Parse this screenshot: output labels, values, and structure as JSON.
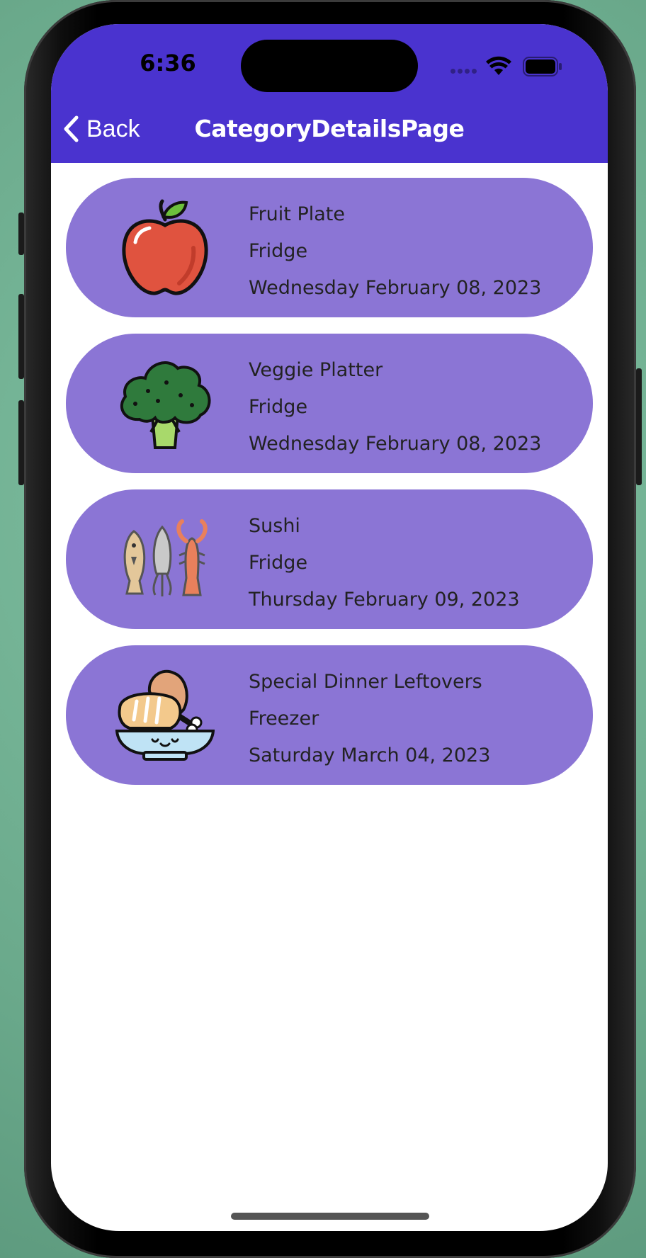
{
  "status_bar": {
    "time": "6:36"
  },
  "nav": {
    "back_label": "Back",
    "title": "CategoryDetailsPage"
  },
  "items": [
    {
      "icon": "apple-icon",
      "name": "Fruit Plate",
      "location": "Fridge",
      "date": "Wednesday February 08, 2023"
    },
    {
      "icon": "broccoli-icon",
      "name": "Veggie Platter",
      "location": "Fridge",
      "date": "Wednesday February 08, 2023"
    },
    {
      "icon": "seafood-icon",
      "name": "Sushi",
      "location": "Fridge",
      "date": "Thursday February 09, 2023"
    },
    {
      "icon": "dinner-plate-icon",
      "name": "Special Dinner Leftovers",
      "location": "Freezer",
      "date": "Saturday March 04, 2023"
    }
  ],
  "colors": {
    "nav_bar": "#4a33cf",
    "card": "#8b75d5",
    "screen_background": "#ffffff"
  }
}
